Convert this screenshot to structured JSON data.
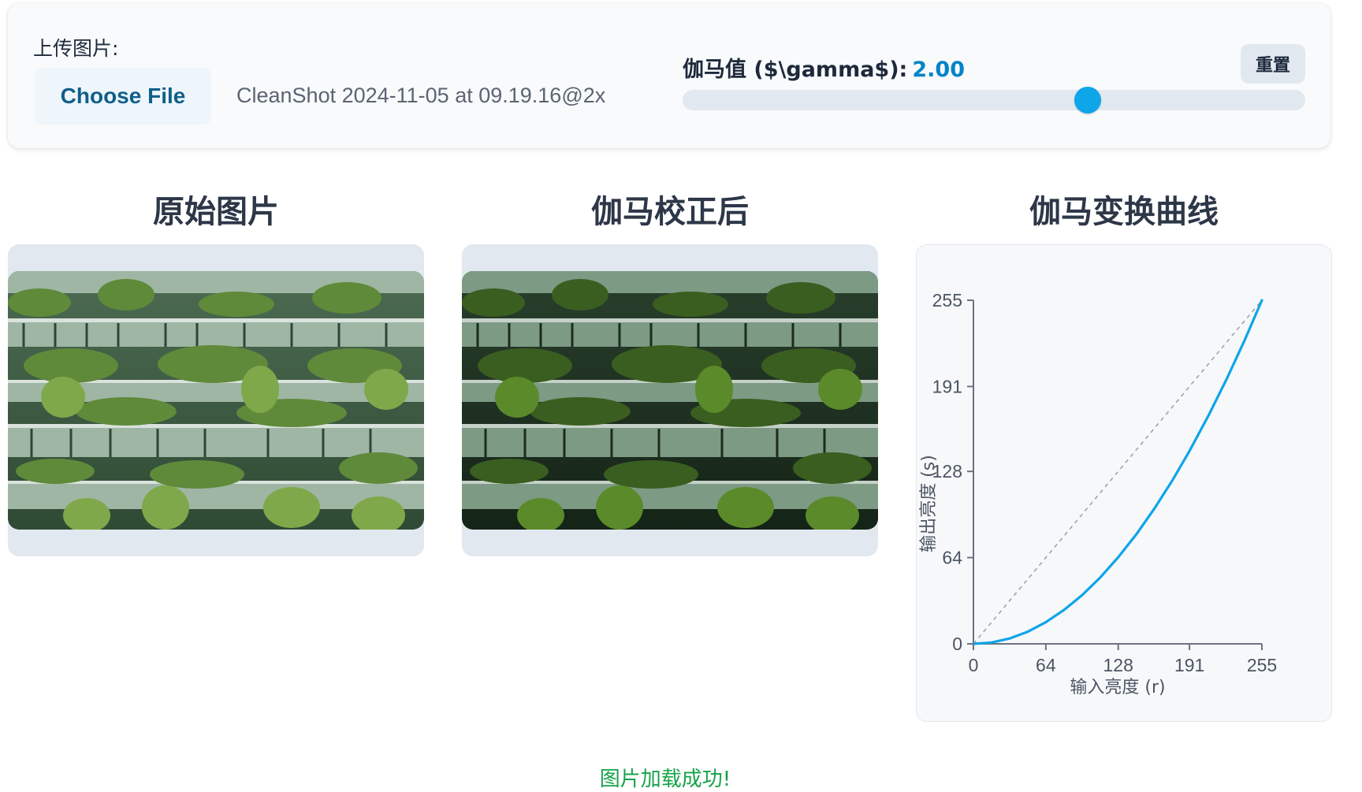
{
  "controls": {
    "upload_label": "上传图片:",
    "choose_file_label": "Choose File",
    "file_name": "CleanShot 2024-11-05 at 09.19.16@2x",
    "gamma_label": "伽马值 ($\\gamma$):",
    "gamma_value": "2.00",
    "gamma_slider_fraction": 0.65,
    "reset_label": "重置"
  },
  "panels": {
    "original_title": "原始图片",
    "corrected_title": "伽马校正后",
    "curve_title": "伽马变换曲线"
  },
  "status_message": "图片加载成功!",
  "colors": {
    "accent": "#0ea5e9",
    "value_text": "#0284c7",
    "success": "#16a34a"
  },
  "chart_data": {
    "type": "line",
    "title": "",
    "xlabel": "输入亮度 (r)",
    "ylabel": "输出亮度 (s)",
    "xlim": [
      0,
      255
    ],
    "ylim": [
      0,
      255
    ],
    "x_ticks": [
      "0",
      "64",
      "128",
      "191",
      "255"
    ],
    "y_ticks": [
      "0",
      "64",
      "128",
      "191",
      "255"
    ],
    "gamma": 2.0,
    "grid": false,
    "series": [
      {
        "style": "solid",
        "color": "#0ea5e9",
        "x": [
          0,
          16,
          32,
          48,
          64,
          80,
          96,
          112,
          128,
          144,
          160,
          176,
          191,
          208,
          224,
          240,
          255
        ],
        "y": [
          0,
          1.0,
          4.0,
          9.0,
          16.1,
          25.1,
          36.1,
          49.2,
          64.3,
          81.3,
          100.4,
          121.5,
          143.1,
          169.7,
          196.8,
          225.9,
          255
        ]
      },
      {
        "style": "dashed",
        "color": "#9ca3af",
        "x": [
          0,
          255
        ],
        "y": [
          0,
          255
        ]
      }
    ]
  }
}
